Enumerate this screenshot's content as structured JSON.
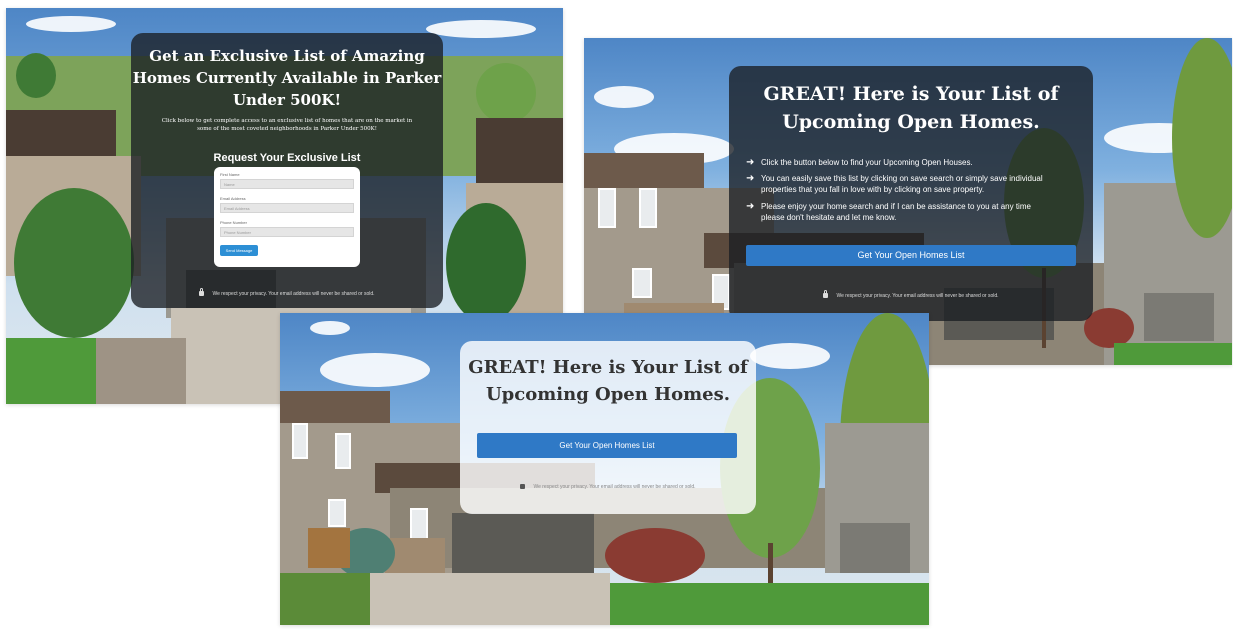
{
  "shot1": {
    "headline_lines": [
      "Get an Exclusive List of Amazing",
      "Homes Currently Available in Parker",
      "Under 500K!"
    ],
    "sub_lines": [
      "Click below to get complete access to an exclusive list of homes that are on the market in",
      "some of the most coveted neighborhoods in Parker Under 500K!"
    ],
    "form_title": "Request Your Exclusive List",
    "fields": [
      {
        "label": "First Name",
        "placeholder": "Name"
      },
      {
        "label": "Email Address",
        "placeholder": "Email Address"
      },
      {
        "label": "Phone Number",
        "placeholder": "Phone Number"
      }
    ],
    "send_label": "Send Message",
    "privacy": "We respect your privacy. Your email address will never be shared or sold."
  },
  "shot2": {
    "headline_lines": [
      "GREAT! Here is Your List of",
      "Upcoming Open Homes."
    ],
    "bullets": [
      {
        "lines": [
          "Click the button below to find your Upcoming Open Houses."
        ]
      },
      {
        "lines": [
          "You can easily save this list by clicking on save search or simply save individual",
          "properties that you fall in love with by clicking on save property."
        ]
      },
      {
        "lines": [
          "Please enjoy your home search and if I can be assistance to you at any time",
          "please don't hesitate and let me know."
        ]
      }
    ],
    "button": "Get Your Open Homes List",
    "privacy": "We respect your privacy. Your email address will never be shared or sold."
  },
  "shot3": {
    "headline_lines": [
      "GREAT! Here is Your List of",
      "Upcoming Open Homes."
    ],
    "button": "Get Your Open Homes List",
    "privacy": "We respect your privacy. Your email address will never be shared or sold."
  },
  "colors": {
    "button_blue": "#2f79c6",
    "send_blue": "#2d8fd5"
  },
  "icons": {
    "bullet": "arrow-right-icon",
    "privacy": "lock-icon"
  }
}
